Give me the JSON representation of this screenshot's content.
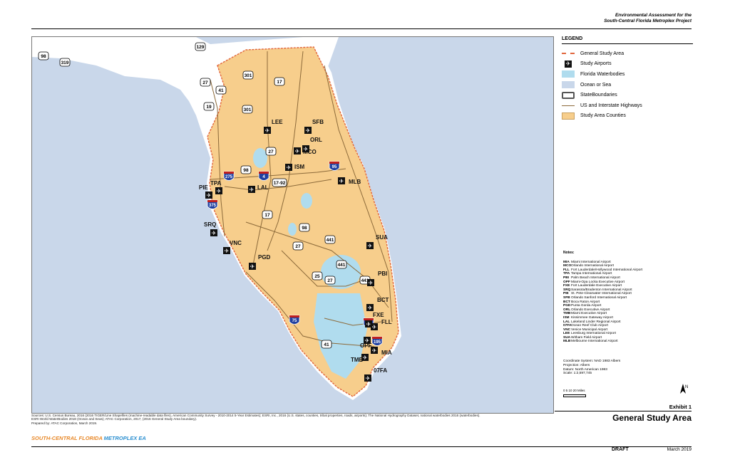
{
  "header": {
    "line1": "Environmental Assessment for the",
    "line2": "South-Central Florida Metroplex Project"
  },
  "colors": {
    "ocean": "#c9d7ea",
    "waterbody": "#b0dcee",
    "study_counties": "#f7ce8c",
    "land": "#ffffff",
    "study_boundary": "#e1663c",
    "highway": "#8c6a3a",
    "interstate_shield": "#2040a0",
    "brand_orange": "#e8892a",
    "brand_blue": "#2b8fd0"
  },
  "legend": {
    "title": "LEGEND",
    "items": [
      {
        "label": "General Study Area",
        "symbol": "dashed-orange-line"
      },
      {
        "label": "Study Airports",
        "symbol": "airport-icon"
      },
      {
        "label": "Florida Waterbodies",
        "symbol": "light-blue-fill"
      },
      {
        "label": "Ocean or Sea",
        "symbol": "pale-blue-fill"
      },
      {
        "label": "StateBoundaries",
        "symbol": "gray-outline-box"
      },
      {
        "label": "US and Interstate Highways",
        "symbol": "brown-line"
      },
      {
        "label": "Study Area Counties",
        "symbol": "tan-fill"
      }
    ]
  },
  "notes": {
    "heading": "Notes:",
    "airports": [
      {
        "code": "MIA",
        "name": "Miami International Airport"
      },
      {
        "code": "MCO",
        "name": "Orlando International Airport"
      },
      {
        "code": "FLL",
        "name": "Fort Lauderdale/Hollywood International Airport"
      },
      {
        "code": "TPA",
        "name": "Tampa International Airport"
      },
      {
        "code": "PBI",
        "name": "Palm Beach International Airport"
      },
      {
        "code": "OPF",
        "name": "Miami-Opa Locka Executive Airport"
      },
      {
        "code": "FXE",
        "name": "Fort Lauderdale Executive Airport"
      },
      {
        "code": "SRQ",
        "name": "Sarasota/Bradenton International Airport"
      },
      {
        "code": "PIE",
        "name": "St. Pete-Clearwater International Airport"
      },
      {
        "code": "SFB",
        "name": "Orlando Sanford International Airport"
      },
      {
        "code": "BCT",
        "name": "Boca Raton Airport"
      },
      {
        "code": "PGD",
        "name": "Punta Gorda Airport"
      },
      {
        "code": "ORL",
        "name": "Orlando Executive Airport"
      },
      {
        "code": "TMB",
        "name": "Miami Executive Airport"
      },
      {
        "code": "ISM",
        "name": "Kissimmee Gateway Airport"
      },
      {
        "code": "LAL",
        "name": "Lakeland Linder Regional Airport"
      },
      {
        "code": "07FA",
        "name": "Ocean Reef Club Airport"
      },
      {
        "code": "VNC",
        "name": "Venice Municipal Airport"
      },
      {
        "code": "LEE",
        "name": "Leesburg International Airport"
      },
      {
        "code": "SUA",
        "name": "Witham Field Airport"
      },
      {
        "code": "MLB",
        "name": "Melbourne International Airport"
      }
    ],
    "coordinate_system": "Coordinate System: NAD 1983 Albers",
    "projection": "Projection: Albers",
    "datum": "Datum: North American 1983",
    "scale": "Scale: 1:2,597,745"
  },
  "scale_bar": {
    "ticks": "0  5  10      20 Miles"
  },
  "map": {
    "airports": [
      {
        "code": "LEE"
      },
      {
        "code": "SFB"
      },
      {
        "code": "ORL"
      },
      {
        "code": "MCO"
      },
      {
        "code": "ISM"
      },
      {
        "code": "MLB"
      },
      {
        "code": "TPA"
      },
      {
        "code": "PIE"
      },
      {
        "code": "LAL"
      },
      {
        "code": "SRQ"
      },
      {
        "code": "VNC"
      },
      {
        "code": "PGD"
      },
      {
        "code": "SUA"
      },
      {
        "code": "PBI"
      },
      {
        "code": "BCT"
      },
      {
        "code": "FXE"
      },
      {
        "code": "FLL"
      },
      {
        "code": "OPF"
      },
      {
        "code": "TMB"
      },
      {
        "code": "MIA"
      },
      {
        "code": "07FA"
      }
    ],
    "us_routes": [
      "98",
      "319",
      "129",
      "301",
      "27",
      "41",
      "17",
      "19",
      "301",
      "27",
      "98",
      "17-92",
      "17",
      "98",
      "27",
      "441",
      "441",
      "25",
      "27",
      "441",
      "41"
    ],
    "interstates": [
      "275",
      "4",
      "95",
      "375",
      "75",
      "595",
      "195"
    ]
  },
  "exhibit": {
    "label": "Exhibit 1",
    "title": "General Study Area"
  },
  "sources": {
    "line1": "Sources:    U.S. Census Bureau, 2016 (2016 TIGER/Line Shapefiles (machine-readable data files), American Community Survey - 2010-2014 5-Year Estimates); ESRI, Inc., 2016  (U.S. states, counties, tribal properties, roads, airports); The National Hydrography Dataset, national waterbodies 2016 (waterbodies).",
    "line2": "ESRI World WaterBodies 2018 (Ocean and Seas);  ATAC Corporation, 2017, (2016  General Study Area boundary).",
    "line3": "Prepared by: ATAC Corporation, March 2019."
  },
  "footer": {
    "brand_part1": "SOUTH-CENTRAL FLORIDA ",
    "brand_part2": "METROPLEX EA",
    "draft": "DRAFT",
    "date": "March 2019"
  }
}
